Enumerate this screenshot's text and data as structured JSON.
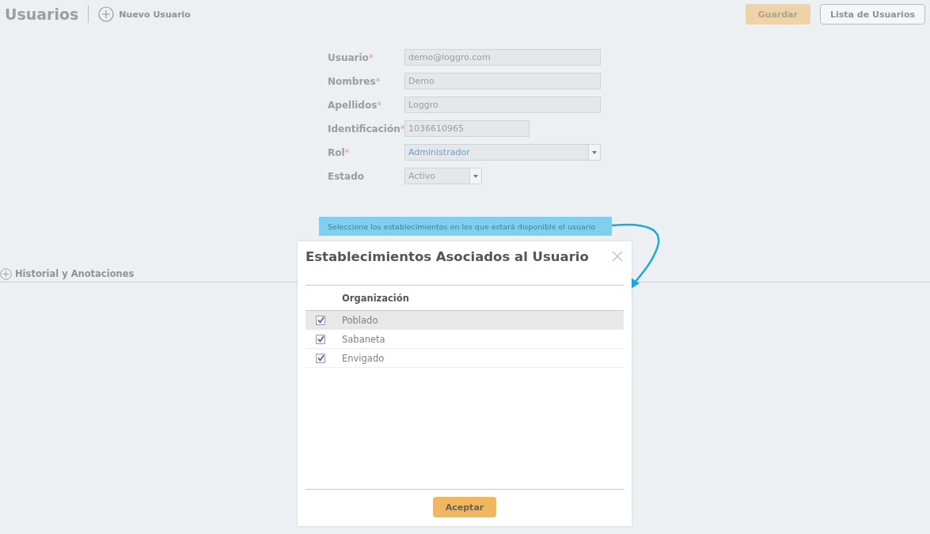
{
  "header": {
    "title": "Usuarios",
    "new_button": "Nuevo Usuario",
    "save_button": {
      "label": "Guardar",
      "disabled": true
    },
    "list_button": "Lista de Usuarios"
  },
  "form": [
    {
      "label": "Usuario",
      "required_mark": "*",
      "kind": "text",
      "value": "demo@loggro.com"
    },
    {
      "label": "Nombres",
      "required_mark": "*",
      "kind": "text",
      "value": "Demo"
    },
    {
      "label": "Apellidos",
      "required_mark": "*",
      "kind": "text",
      "value": "Loggro"
    },
    {
      "label": "Identificación",
      "required_mark": "*",
      "kind": "short-text",
      "value": "1036610965"
    },
    {
      "label": "Rol",
      "required_mark": "*",
      "kind": "select",
      "value": "Administrador"
    },
    {
      "label": "Estado",
      "kind": "short-select",
      "value": "Activo"
    }
  ],
  "hint": "Seleccione los establecimientos en los que estará disponible el usuario",
  "section": "Historial y Anotaciones",
  "dialog": {
    "title": "Establecimientos Asociados al Usuario",
    "column": "Organización",
    "rows": [
      {
        "name": "Poblado",
        "checked": true,
        "selected": true
      },
      {
        "name": "Sabaneta",
        "checked": true,
        "selected": false
      },
      {
        "name": "Envigado",
        "checked": true,
        "selected": false
      }
    ],
    "accept": "Aceptar"
  }
}
